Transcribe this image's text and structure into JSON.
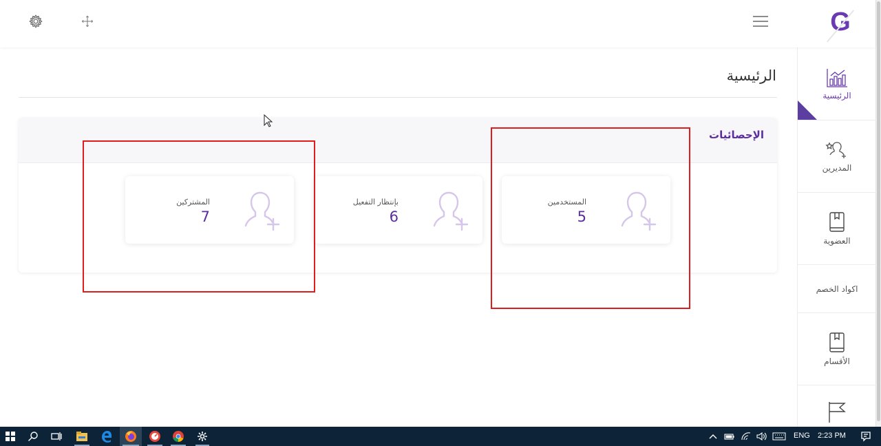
{
  "app": {
    "logo_letter": "G",
    "colors": {
      "brand": "#6a3bb0",
      "accent": "#5b2d9e",
      "highlight": "#e01b1b",
      "taskbar": "#0d2438"
    }
  },
  "topbar": {
    "icons": [
      "settings-gear-icon",
      "fullscreen-move-icon",
      "hamburger-menu-icon"
    ]
  },
  "sidebar": {
    "items": [
      {
        "label": "الرئيسية",
        "icon": "bar-chart-icon",
        "active": true
      },
      {
        "label": "المديرين",
        "icon": "user-star-add-icon",
        "active": false
      },
      {
        "label": "العضوية",
        "icon": "book-icon",
        "active": false
      },
      {
        "label": "اكواد الخصم",
        "icon": "",
        "active": false
      },
      {
        "label": "الأقسام",
        "icon": "book-icon",
        "active": false
      },
      {
        "label": "",
        "icon": "flag-icon",
        "active": false
      }
    ]
  },
  "main": {
    "page_title": "الرئيسية",
    "stats": {
      "heading": "الإحصائيات",
      "cards": [
        {
          "label": "المستخدمين",
          "value": "5",
          "icon": "user-add-icon"
        },
        {
          "label": "بإنتظار التفعيل",
          "value": "6",
          "icon": "user-add-icon"
        },
        {
          "label": "المشتركين",
          "value": "7",
          "icon": "user-add-icon"
        }
      ]
    }
  },
  "taskbar": {
    "apps": [
      "windows-start-icon",
      "search-icon",
      "task-view-icon",
      "file-explorer-icon",
      "edge-icon",
      "firefox-icon",
      "app-red-icon",
      "chrome-icon",
      "settings-icon"
    ],
    "language": "ENG",
    "time": "2:23 PM"
  }
}
